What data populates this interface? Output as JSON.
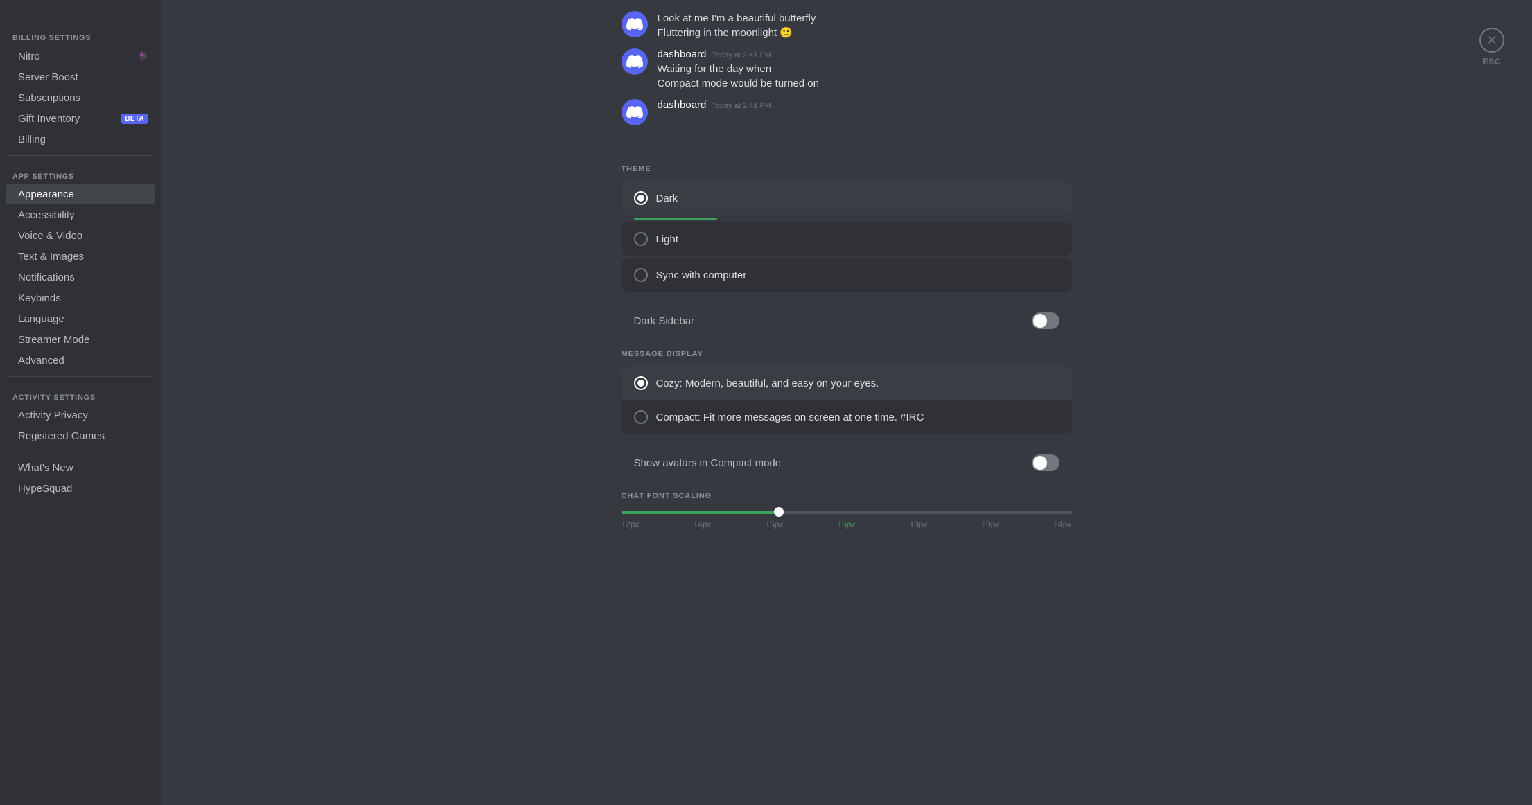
{
  "sidebar": {
    "billing_section_label": "BILLING SETTINGS",
    "app_section_label": "APP SETTINGS",
    "activity_section_label": "ACTIVITY SETTINGS",
    "items": {
      "nitro": "Nitro",
      "server_boost": "Server Boost",
      "subscriptions": "Subscriptions",
      "gift_inventory": "Gift Inventory",
      "billing": "Billing",
      "appearance": "Appearance",
      "accessibility": "Accessibility",
      "voice_video": "Voice & Video",
      "text_images": "Text & Images",
      "notifications": "Notifications",
      "keybinds": "Keybinds",
      "language": "Language",
      "streamer_mode": "Streamer Mode",
      "advanced": "Advanced",
      "activity_privacy": "Activity Privacy",
      "registered_games": "Registered Games",
      "whats_new": "What's New",
      "hypesquad": "HypeSquad"
    },
    "beta_label": "BETA"
  },
  "chat_preview": {
    "messages": [
      {
        "author": "",
        "time": "",
        "lines": [
          "Look at me I'm a beautiful butterfly",
          "Fluttering in the moonlight 🙂"
        ]
      },
      {
        "author": "dashboard",
        "time": "Today at 2:41 PM",
        "lines": [
          "Waiting for the day when",
          "Compact mode would be turned on"
        ]
      },
      {
        "author": "dashboard",
        "time": "Today at 2:41 PM",
        "lines": []
      }
    ]
  },
  "settings": {
    "theme_section_title": "THEME",
    "theme_options": [
      {
        "id": "dark",
        "label": "Dark",
        "selected": true
      },
      {
        "id": "light",
        "label": "Light",
        "selected": false
      },
      {
        "id": "sync",
        "label": "Sync with computer",
        "selected": false
      }
    ],
    "dark_sidebar_label": "Dark Sidebar",
    "dark_sidebar_enabled": false,
    "message_display_title": "MESSAGE DISPLAY",
    "message_options": [
      {
        "id": "cozy",
        "label": "Cozy: Modern, beautiful, and easy on your eyes.",
        "selected": true
      },
      {
        "id": "compact",
        "label": "Compact: Fit more messages on screen at one time. #IRC",
        "selected": false
      }
    ],
    "show_avatars_label": "Show avatars in Compact mode",
    "show_avatars_enabled": false,
    "chat_font_scaling_title": "CHAT FONT SCALING",
    "font_sizes": [
      "12px",
      "14px",
      "15px",
      "16px",
      "18px",
      "20px",
      "24px"
    ],
    "active_font_size": "16px",
    "slider_percent": 35
  },
  "esc": {
    "label": "ESC"
  }
}
